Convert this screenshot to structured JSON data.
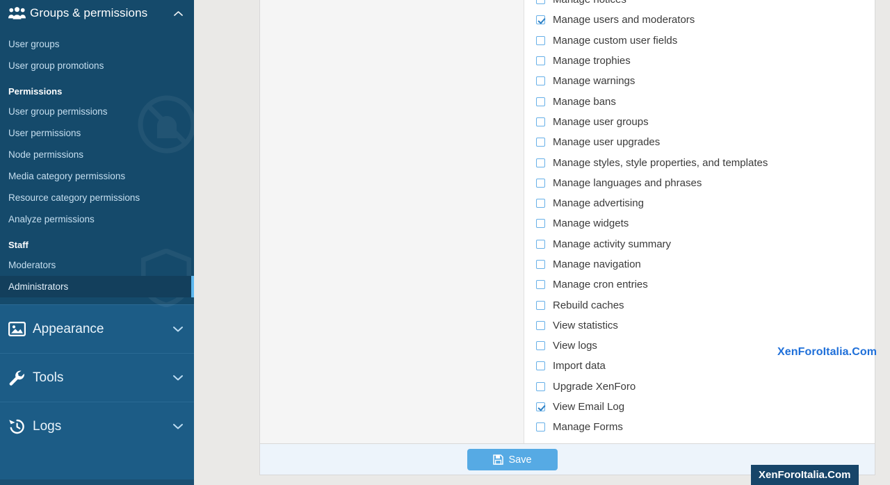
{
  "sidebar": {
    "active_group": {
      "title": "Groups & permissions",
      "icon": "users-group-icon",
      "chevron": "chevron-up-icon",
      "links": [
        {
          "label": "User groups",
          "active": false
        },
        {
          "label": "User group promotions",
          "active": false
        }
      ],
      "sections": [
        {
          "heading": "Permissions",
          "links": [
            {
              "label": "User group permissions",
              "active": false
            },
            {
              "label": "User permissions",
              "active": false
            },
            {
              "label": "Node permissions",
              "active": false
            },
            {
              "label": "Media category permissions",
              "active": false
            },
            {
              "label": "Resource category permissions",
              "active": false
            },
            {
              "label": "Analyze permissions",
              "active": false
            }
          ]
        },
        {
          "heading": "Staff",
          "links": [
            {
              "label": "Moderators",
              "active": false
            },
            {
              "label": "Administrators",
              "active": true
            }
          ]
        }
      ]
    },
    "collapsed_groups": [
      {
        "label": "Appearance",
        "icon": "image-icon",
        "chevron": "chevron-down-icon"
      },
      {
        "label": "Tools",
        "icon": "wrench-icon",
        "chevron": "chevron-down-icon"
      },
      {
        "label": "Logs",
        "icon": "history-clock-icon",
        "chevron": "chevron-down-icon"
      }
    ]
  },
  "permissions": {
    "items": [
      {
        "label": "Manage notices",
        "checked": false
      },
      {
        "label": "Manage users and moderators",
        "checked": true
      },
      {
        "label": "Manage custom user fields",
        "checked": false
      },
      {
        "label": "Manage trophies",
        "checked": false
      },
      {
        "label": "Manage warnings",
        "checked": false
      },
      {
        "label": "Manage bans",
        "checked": false
      },
      {
        "label": "Manage user groups",
        "checked": false
      },
      {
        "label": "Manage user upgrades",
        "checked": false
      },
      {
        "label": "Manage styles, style properties, and templates",
        "checked": false
      },
      {
        "label": "Manage languages and phrases",
        "checked": false
      },
      {
        "label": "Manage advertising",
        "checked": false
      },
      {
        "label": "Manage widgets",
        "checked": false
      },
      {
        "label": "Manage activity summary",
        "checked": false
      },
      {
        "label": "Manage navigation",
        "checked": false
      },
      {
        "label": "Manage cron entries",
        "checked": false
      },
      {
        "label": "Rebuild caches",
        "checked": false
      },
      {
        "label": "View statistics",
        "checked": false
      },
      {
        "label": "View logs",
        "checked": false
      },
      {
        "label": "Import data",
        "checked": false
      },
      {
        "label": "Upgrade XenForo",
        "checked": false
      },
      {
        "label": "View Email Log",
        "checked": true
      },
      {
        "label": "Manage Forms",
        "checked": false
      }
    ]
  },
  "form_bar": {
    "save_label": "Save",
    "save_icon": "floppy-disk-icon"
  },
  "watermarks": {
    "text": "XenForoItalia.Com",
    "badge": "XenForoItalia.Com"
  },
  "colors": {
    "sidebar_bg": "#1c5c86",
    "sidebar_open_bg": "#154a6b",
    "sidebar_active_bg": "#133f5c",
    "sidebar_active_indicator": "#5eb8ef",
    "checkbox_border": "#67b0e8",
    "checkbox_check": "#2b7fc4",
    "save_button": "#56aae4",
    "formbar_bg": "#edf4fb",
    "watermark_blue": "#1e6fd9",
    "watermark_badge_bg": "#174569"
  }
}
